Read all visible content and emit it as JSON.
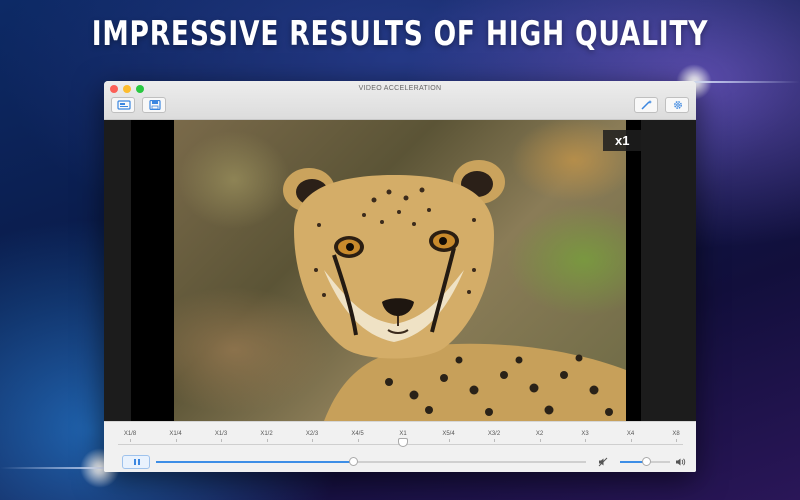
{
  "headline": "IMPRESSIVE RESULTS OF HIGH QUALITY",
  "colors": {
    "accent": "#3d8ee6",
    "close": "#fc5f57",
    "minimize": "#fdbc2e",
    "maximize": "#28c840"
  },
  "window": {
    "title": "VIDEO ACCELERATION",
    "toolbar_left": [
      {
        "icon": "video-panel-icon"
      },
      {
        "icon": "save-icon"
      }
    ],
    "toolbar_right": [
      {
        "icon": "magic-wand-icon"
      },
      {
        "icon": "gear-icon"
      }
    ]
  },
  "video": {
    "speed_badge": "x1"
  },
  "controls": {
    "speed_options": [
      "X1/8",
      "X1/4",
      "X1/3",
      "X1/2",
      "X2/3",
      "X4/5",
      "X1",
      "X5/4",
      "X3/2",
      "X2",
      "X3",
      "X4",
      "X8"
    ],
    "selected_speed": "X1",
    "playback_state_icon": "pause-icon",
    "progress_fraction": 0.46,
    "volume_fraction": 0.52,
    "mute_icon": "speaker-muted-icon",
    "volume_icon": "speaker-icon"
  }
}
